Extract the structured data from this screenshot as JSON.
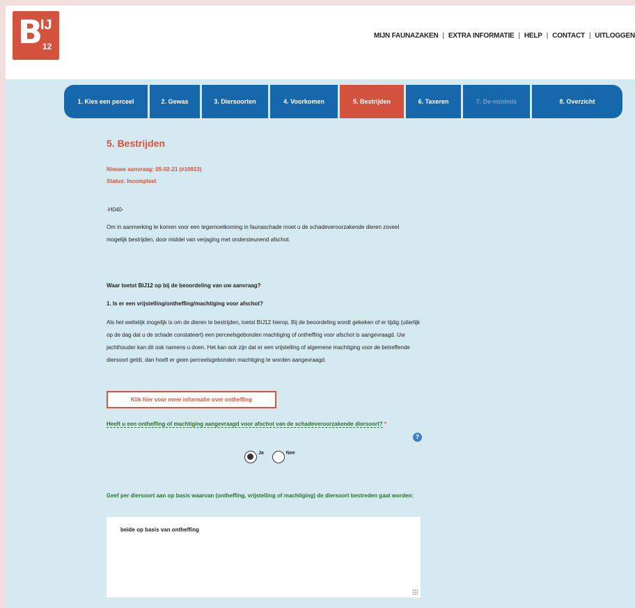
{
  "logo": {
    "text_b": "B",
    "text_ij": "IJ",
    "text_num": "12"
  },
  "topnav": [
    "MIJN FAUNAZAKEN",
    "EXTRA INFORMATIE",
    "HELP",
    "CONTACT",
    "UITLOGGEN"
  ],
  "tabs": [
    {
      "label": "1. Kies een perceel"
    },
    {
      "label": "2. Gewas"
    },
    {
      "label": "3. Diersoorten"
    },
    {
      "label": "4. Voorkomen"
    },
    {
      "label": "5. Bestrijden"
    },
    {
      "label": "6. Taxeren"
    },
    {
      "label": "7. De-minimis"
    },
    {
      "label": "8. Overzicht"
    }
  ],
  "page": {
    "title": "5. Bestrijden",
    "request": "Nieuwe aanvraag: 05-02-21 (#10913)",
    "status": "Status: Incompleet",
    "code": "-H040-",
    "intro": "Om in aanmerking te komen voor een tegemoetkoming in faunaschade moet u de schadeveroorzakende dieren zoveel mogelijk bestrijden, door middel van verjaging met ondersteunend afschot.",
    "q_heading": "Waar toetst BIJ12 op bij de beoordeling van uw aanvraag?",
    "q_sub": "1. Is er een vrijstelling/ontheffing/machtiging voor afschot?",
    "paragraph": "Als het wettelijk mogelijk is om de dieren te bestrijden, toetst BIJ12 hierop. Bij de beoordeling wordt gekeken of er tijdig (uiterlijk op de dag dat u de schade constateert) een perceelsgebonden machtiging of ontheffing voor afschot is aangevraagd. Uw jachthouder kan dit ook namens u doen. Het kan ook zijn dat er een vrijstelling of algemene machtiging voor de betreffende diersoort geldt, dan hoeft er geen perceelsgebonden machtiging te worden aangevraagd.",
    "info_button": "Klik hier voor meer informatie over ontheffing",
    "question": "Heeft u een ontheffing of machtiging aangevraagd voor afschot van de schadeveroorzakende diersoort?",
    "required_mark": "*",
    "help_icon": "?",
    "radio_yes": "Ja",
    "radio_no": "Nee",
    "question2": "Geef per diersoort aan op basis waarvan (ontheffing, vrijstelling of machtiging) de diersoort bestreden gaat worden:",
    "answer": "beide op basis van ontheffing"
  }
}
